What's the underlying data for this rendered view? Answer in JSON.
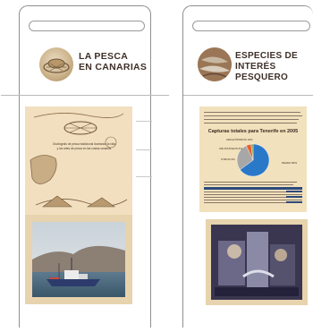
{
  "panels": {
    "left": {
      "title": "LA PESCA\nEN CANARIAS",
      "illustration_text": "Oscilógrafo de pesca tradicional ilustrando la vida y las artes de pesca en las costas canarias"
    },
    "right": {
      "title": "ESPECIES DE\nINTERÉS PESQUERO",
      "chart_title": "Capturas totales para Tenerife en 2005",
      "pie_labels": [
        "CEFALÓPODOS 10%",
        "CRUSTÁCEOS 5%",
        "OTROS 2%",
        "PECES 65%"
      ]
    }
  },
  "colors": {
    "parchment": "#f2e1bd",
    "title_brown": "#3e2f28",
    "pie_blue": "#2a78c8",
    "pie_gray": "#a7a7a7",
    "pie_orange": "#e8602a",
    "pie_green": "#7ca25a"
  },
  "chart_data": {
    "type": "pie",
    "title": "Capturas totales para Tenerife en 2005",
    "categories": [
      "PECES",
      "CEFALÓPODOS",
      "CRUSTÁCEOS",
      "OTROS"
    ],
    "values": [
      65,
      28,
      5,
      2
    ]
  }
}
